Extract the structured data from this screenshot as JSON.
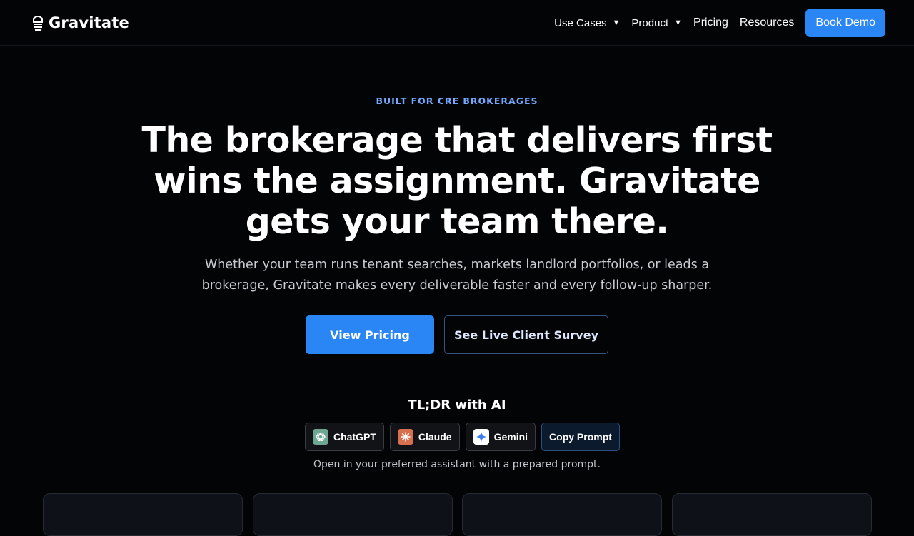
{
  "nav": {
    "brand": "Gravitate",
    "items": [
      {
        "label": "Use Cases",
        "has_menu": true
      },
      {
        "label": "Product",
        "has_menu": true
      },
      {
        "label": "Pricing",
        "has_menu": false
      },
      {
        "label": "Resources",
        "has_menu": false
      }
    ],
    "caret": "▼",
    "cta_label": "Book Demo"
  },
  "hero": {
    "eyebrow": "BUILT FOR CRE BROKERAGES",
    "headline": "The brokerage that delivers first wins the assignment. Gravitate gets your team there.",
    "subhead": "Whether your team runs tenant searches, markets landlord portfolios, or leads a brokerage, Gravitate makes every deliverable faster and every follow-up sharper.",
    "primary_cta": "View Pricing",
    "secondary_cta": "See Live Client Survey"
  },
  "tldr": {
    "title": "TL;DR with AI",
    "assistants": [
      {
        "label": "ChatGPT",
        "icon": "chatgpt-icon"
      },
      {
        "label": "Claude",
        "icon": "claude-icon"
      },
      {
        "label": "Gemini",
        "icon": "gemini-icon"
      }
    ],
    "copy_label": "Copy Prompt",
    "note": "Open in your preferred assistant with a prepared prompt."
  },
  "colors": {
    "background": "#030405",
    "accent": "#2a86f5",
    "eyebrow": "#74a9ff"
  }
}
